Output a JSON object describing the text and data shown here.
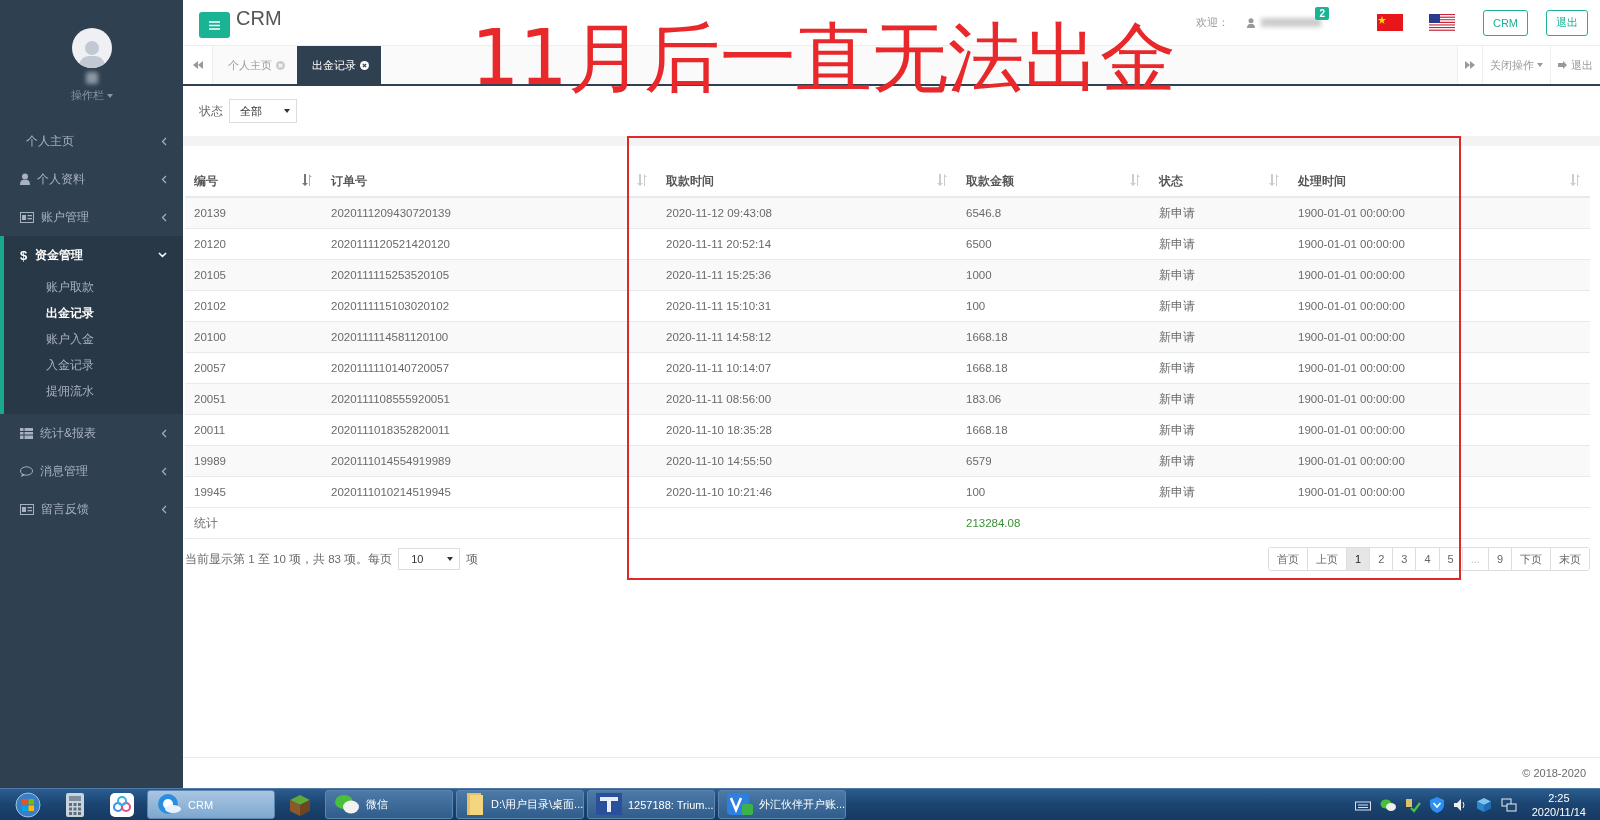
{
  "sidebar": {
    "user_menu": "操作栏",
    "menu": [
      {
        "label": "个人主页",
        "expanded": false
      },
      {
        "label": "个人资料",
        "expanded": false
      },
      {
        "label": "账户管理",
        "expanded": false
      },
      {
        "label": "资金管理",
        "glyph": "$",
        "expanded": true,
        "children": [
          {
            "label": "账户取款",
            "selected": false
          },
          {
            "label": "出金记录",
            "selected": true
          },
          {
            "label": "账户入金",
            "selected": false
          },
          {
            "label": "入金记录",
            "selected": false
          },
          {
            "label": "提佣流水",
            "selected": false
          }
        ]
      },
      {
        "label": "统计&报表",
        "expanded": false
      },
      {
        "label": "消息管理",
        "expanded": false
      },
      {
        "label": "留言反馈",
        "expanded": false
      }
    ]
  },
  "header": {
    "title": "CRM",
    "welcome": "欢迎：",
    "badge": "2",
    "buttons": [
      "CRM",
      "退出"
    ]
  },
  "tabs": [
    {
      "label": "个人主页",
      "selected": false
    },
    {
      "label": "出金记录",
      "selected": true
    }
  ],
  "tab_tools": {
    "close_menu": "关闭操作",
    "logout": "退出"
  },
  "filter": {
    "label": "状态",
    "value": "全部"
  },
  "table": {
    "columns": [
      {
        "label": "编号",
        "sorted": true
      },
      {
        "label": "订单号",
        "sorted": false
      },
      {
        "label": "取款时间",
        "sorted": false
      },
      {
        "label": "取款金额",
        "sorted": false
      },
      {
        "label": "状态",
        "sorted": false
      },
      {
        "label": "处理时间",
        "sorted": false
      }
    ],
    "rows": [
      [
        "20139",
        "2020111209430720139",
        "2020-11-12 09:43:08",
        "6546.8",
        "新申请",
        "1900-01-01 00:00:00"
      ],
      [
        "20120",
        "2020111120521420120",
        "2020-11-11 20:52:14",
        "6500",
        "新申请",
        "1900-01-01 00:00:00"
      ],
      [
        "20105",
        "2020111115253520105",
        "2020-11-11 15:25:36",
        "1000",
        "新申请",
        "1900-01-01 00:00:00"
      ],
      [
        "20102",
        "2020111115103020102",
        "2020-11-11 15:10:31",
        "100",
        "新申请",
        "1900-01-01 00:00:00"
      ],
      [
        "20100",
        "2020111114581120100",
        "2020-11-11 14:58:12",
        "1668.18",
        "新申请",
        "1900-01-01 00:00:00"
      ],
      [
        "20057",
        "2020111110140720057",
        "2020-11-11 10:14:07",
        "1668.18",
        "新申请",
        "1900-01-01 00:00:00"
      ],
      [
        "20051",
        "2020111108555920051",
        "2020-11-11 08:56:00",
        "183.06",
        "新申请",
        "1900-01-01 00:00:00"
      ],
      [
        "20011",
        "2020111018352820011",
        "2020-11-10 18:35:28",
        "1668.18",
        "新申请",
        "1900-01-01 00:00:00"
      ],
      [
        "19989",
        "2020111014554919989",
        "2020-11-10 14:55:50",
        "6579",
        "新申请",
        "1900-01-01 00:00:00"
      ],
      [
        "19945",
        "2020111010214519945",
        "2020-11-10 10:21:46",
        "100",
        "新申请",
        "1900-01-01 00:00:00"
      ]
    ],
    "total": {
      "label": "统计",
      "amount": "213284.08"
    }
  },
  "pagination": {
    "info": "当前显示第 1 至 10 项，共 83 项。每页",
    "page_size": "10",
    "suffix": "项",
    "pages": [
      {
        "label": "首页",
        "selected": false,
        "disabled": false
      },
      {
        "label": "上页",
        "selected": false,
        "disabled": false
      },
      {
        "label": "1",
        "selected": true,
        "disabled": false
      },
      {
        "label": "2",
        "selected": false,
        "disabled": false
      },
      {
        "label": "3",
        "selected": false,
        "disabled": false
      },
      {
        "label": "4",
        "selected": false,
        "disabled": false
      },
      {
        "label": "5",
        "selected": false,
        "disabled": false
      },
      {
        "label": "...",
        "selected": false,
        "disabled": true
      },
      {
        "label": "9",
        "selected": false,
        "disabled": false
      },
      {
        "label": "下页",
        "selected": false,
        "disabled": false
      },
      {
        "label": "末页",
        "selected": false,
        "disabled": false
      }
    ]
  },
  "footer": "© 2018-2020",
  "annotation": "11月后一直无法出金",
  "taskbar": {
    "items": [
      {
        "label": "CRM",
        "active": true
      },
      {
        "label": "微信",
        "active": false
      },
      {
        "label": "D:\\用户目录\\桌面...",
        "active": false
      },
      {
        "label": "1257188: Trium...",
        "active": false
      },
      {
        "label": "外汇伙伴开户账...",
        "active": false
      }
    ],
    "time": "2:25",
    "date": "2020/11/14"
  }
}
